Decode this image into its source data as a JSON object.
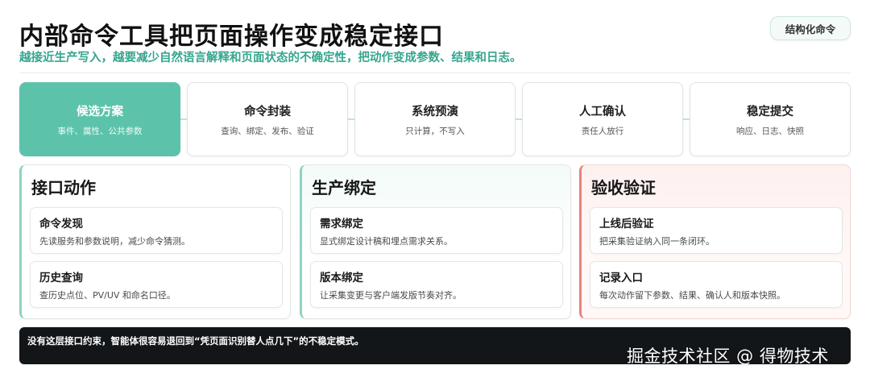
{
  "header": {
    "title": "内部命令工具把页面操作变成稳定接口",
    "subtitle": "越接近生产写入，越要减少自然语言解释和页面状态的不确定性，把动作变成参数、结果和日志。",
    "tag": "结构化命令"
  },
  "steps": [
    {
      "title": "候选方案",
      "desc": "事件、属性、公共参数",
      "active": true
    },
    {
      "title": "命令封装",
      "desc": "查询、绑定、发布、验证",
      "active": false
    },
    {
      "title": "系统预演",
      "desc": "只计算，不写入",
      "active": false
    },
    {
      "title": "人工确认",
      "desc": "责任人放行",
      "active": false
    },
    {
      "title": "稳定提交",
      "desc": "响应、日志、快照",
      "active": false
    }
  ],
  "columns": [
    {
      "title": "接口动作",
      "cards": [
        {
          "title": "命令发现",
          "desc": "先读服务和参数说明，减少命令猜测。"
        },
        {
          "title": "历史查询",
          "desc": "查历史点位、PV/UV 和命名口径。"
        }
      ]
    },
    {
      "title": "生产绑定",
      "cards": [
        {
          "title": "需求绑定",
          "desc": "显式绑定设计稿和埋点需求关系。"
        },
        {
          "title": "版本绑定",
          "desc": "让采集变更与客户端发版节奏对齐。"
        }
      ]
    },
    {
      "title": "验收验证",
      "cards": [
        {
          "title": "上线后验证",
          "desc": "把采集验证纳入同一条闭环。"
        },
        {
          "title": "记录入口",
          "desc": "每次动作留下参数、结果、确认人和版本快照。"
        }
      ]
    }
  ],
  "footer": {
    "text": "没有这层接口约束，智能体很容易退回到“凭页面识别替人点几下”的不稳定模式。"
  },
  "watermark": "掘金技术社区 @ 得物技术",
  "colors": {
    "accent": "#5cc3aa",
    "subtitle": "#35a68e",
    "warning_border": "#e9837a",
    "footer_bg": "#131619"
  }
}
